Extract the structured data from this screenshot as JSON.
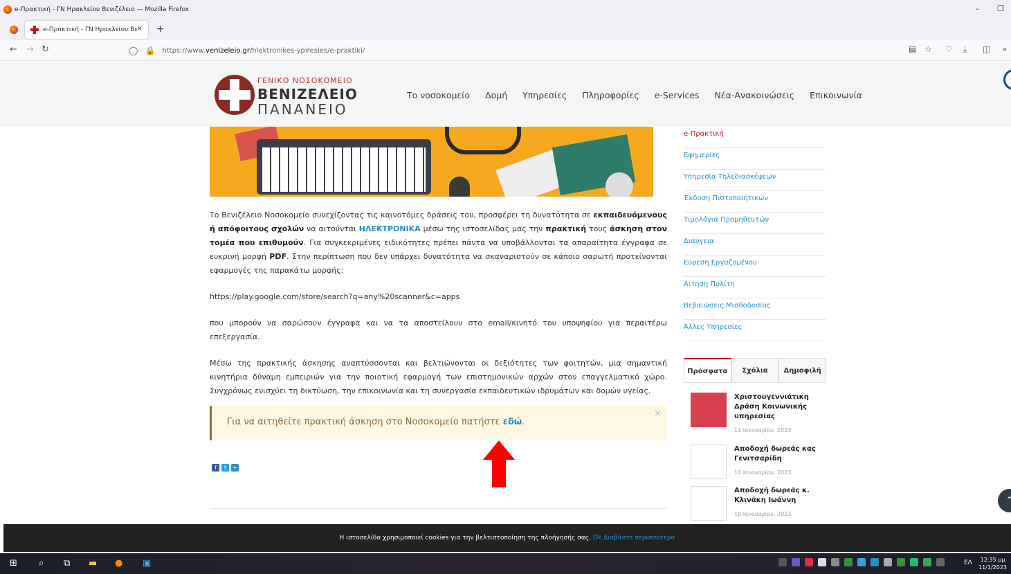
{
  "window": {
    "title": "e-Πρακτική - ΓΝ Ηρακλείου Βενιζέλειο — Mozilla Firefox"
  },
  "tab": {
    "title": "e-Πρακτική - ΓΝ Ηρακλείου Βε",
    "close": "×",
    "new": "+"
  },
  "url": {
    "prefix": "https://www.",
    "domain": "venizeleio.gr",
    "path": "/hlektronikes-ypiresies/e-praktiki/"
  },
  "logo": {
    "line1": "ΓΕΝΙΚΟ ΝΟΣΟΚΟΜΕΙΟ",
    "line2": "ΒΕΝΙΖΕΛΕΙΟ",
    "line3": "ΠΑΝΑΝΕΙΟ"
  },
  "nav": [
    "Το νοσοκομείο",
    "Δομή",
    "Υπηρεσίες",
    "Πληροφορίες",
    "e-Services",
    "Νέα-Ανακοινώσεις",
    "Επικοινωνία"
  ],
  "content": {
    "p1_a": "Το Βενιζέλειο Νοσοκομείο συνεχίζοντας τις καινοτόμες δράσεις του, προσφέρει τη δυνατότητα σε ",
    "p1_b1": "εκπαιδευόμενους ή απόφοιτους σχολών",
    "p1_c": " να αιτούνται ",
    "p1_b2": "ΗΛΕΚΤΡΟΝΙΚΑ",
    "p1_d": " μέσω της ιστοσελίδας μας την ",
    "p1_b3": "πρακτική",
    "p1_e": " τους ",
    "p1_b4": "άσκηση στον τομέα που επιθυμούν",
    "p1_f": ". Για συγκεκριμένες ειδικότητες πρέπει πάντα να υποβάλλονται τα απαραίτητα έγγραφα σε ευκρινή μορφή ",
    "p1_b5": "PDF",
    "p1_g": ". Στην περίπτωση που δεν υπάρχει δυνατότητα να σκαναριστούν σε κάποιο σαρωτή προτείνονται εφαρμογές της παρακάτω μορφής:",
    "p2": "https://play.google.com/store/search?q=any%20scanner&c=apps",
    "p3": "που μπορούν να σαρώσουν έγγραφα και να τα αποστείλουν στο email/κινητό του υποψηφίου για περαιτέρω επεξεργασία.",
    "p4": "Μέσω της πρακτικής άσκησης αναπτύσσονται και βελτιώνονται οι δεξιότητες των φοιτητών, μια σημαντική κινητήρια δύναμη εμπειριών για την ποιοτική εφαρμογή των επιστημονικών αρχών στον επαγγελματικό χώρο. Συγχρόνως ενισχύει τη δικτύωση, την επικοινωνία και τη συνεργασία εκπαιδευτικών ιδρυμάτων και δομών υγείας."
  },
  "notice": {
    "text": "Για να αιτηθείτε πρακτική άσκηση στο Νοσοκομείο πατήστε ",
    "link": "εδώ",
    "end": ".",
    "close": "×"
  },
  "sidebar": [
    "e-Πρακτική",
    "Εφημερίες",
    "Υπηρεσία Τηλεδιασκέψεων",
    "Έκδοση Πιστοποιητικών",
    "Τιμολόγια Προμηθευτών",
    "Διαύγεια",
    "Εύρεση Εργαζομένου",
    "Αίτηση Πολίτη",
    "Βεβαιώσεις Μισθοδοσίας",
    "Άλλες Υπηρεσίες"
  ],
  "tabs": [
    "Πρόσφατα",
    "Σχόλια",
    "Δημοφιλή"
  ],
  "posts": [
    {
      "title": "Χριστουγεννιάτικη Δράση Κοινωνικής υπηρεσίας",
      "date": "11 Ιανουαρίου, 2023"
    },
    {
      "title": "Αποδοχή δωρεάς κας Γενιτσαρίδη",
      "date": "10 Ιανουαρίου, 2023"
    },
    {
      "title": "Αποδοχή δωρεάς κ. Κλινάκη Ιωάννη",
      "date": "10 Ιανουαρίου, 2023"
    }
  ],
  "cookie": {
    "text": "Η ιστοσελίδα χρησιμοποιεί cookies για την βελτιστοποίηση της πλοήγησής σας.",
    "ok": "Ok",
    "more": "Διαβάστε περισσότερα"
  },
  "taskbar": {
    "lang": "ΕΛ",
    "time": "12:35 μμ",
    "date": "11/1/2023"
  },
  "colors": {
    "accent_red": "#b1232a",
    "link_blue": "#2a8fc6",
    "notice_bg": "#fcf8e3",
    "arrow_red": "#ff0000"
  }
}
